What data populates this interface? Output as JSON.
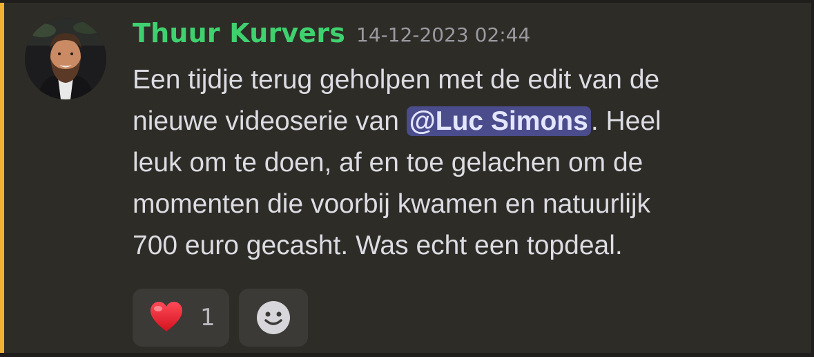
{
  "message": {
    "author": "Thuur Kurvers",
    "timestamp": "14-12-2023 02:44",
    "lines": [
      "Een tijdje terug geholpen met de edit van de",
      "nieuwe videoserie van ",
      ". Heel",
      "leuk om te doen, af en toe gelachen om de",
      "momenten die voorbij kwamen en natuurlijk",
      "700 euro gecasht. Was echt een topdeal."
    ],
    "mention": "@Luc Simons"
  },
  "reactions": [
    {
      "emoji": "heart-icon",
      "count": "1"
    }
  ],
  "colors": {
    "author": "#3fd16f",
    "accent": "#f0b232",
    "mention_bg": "#4a4c8c",
    "background": "#2e2c27"
  },
  "icons": {
    "avatar": "user-avatar",
    "add_reaction": "smiley-add-reaction-icon"
  }
}
